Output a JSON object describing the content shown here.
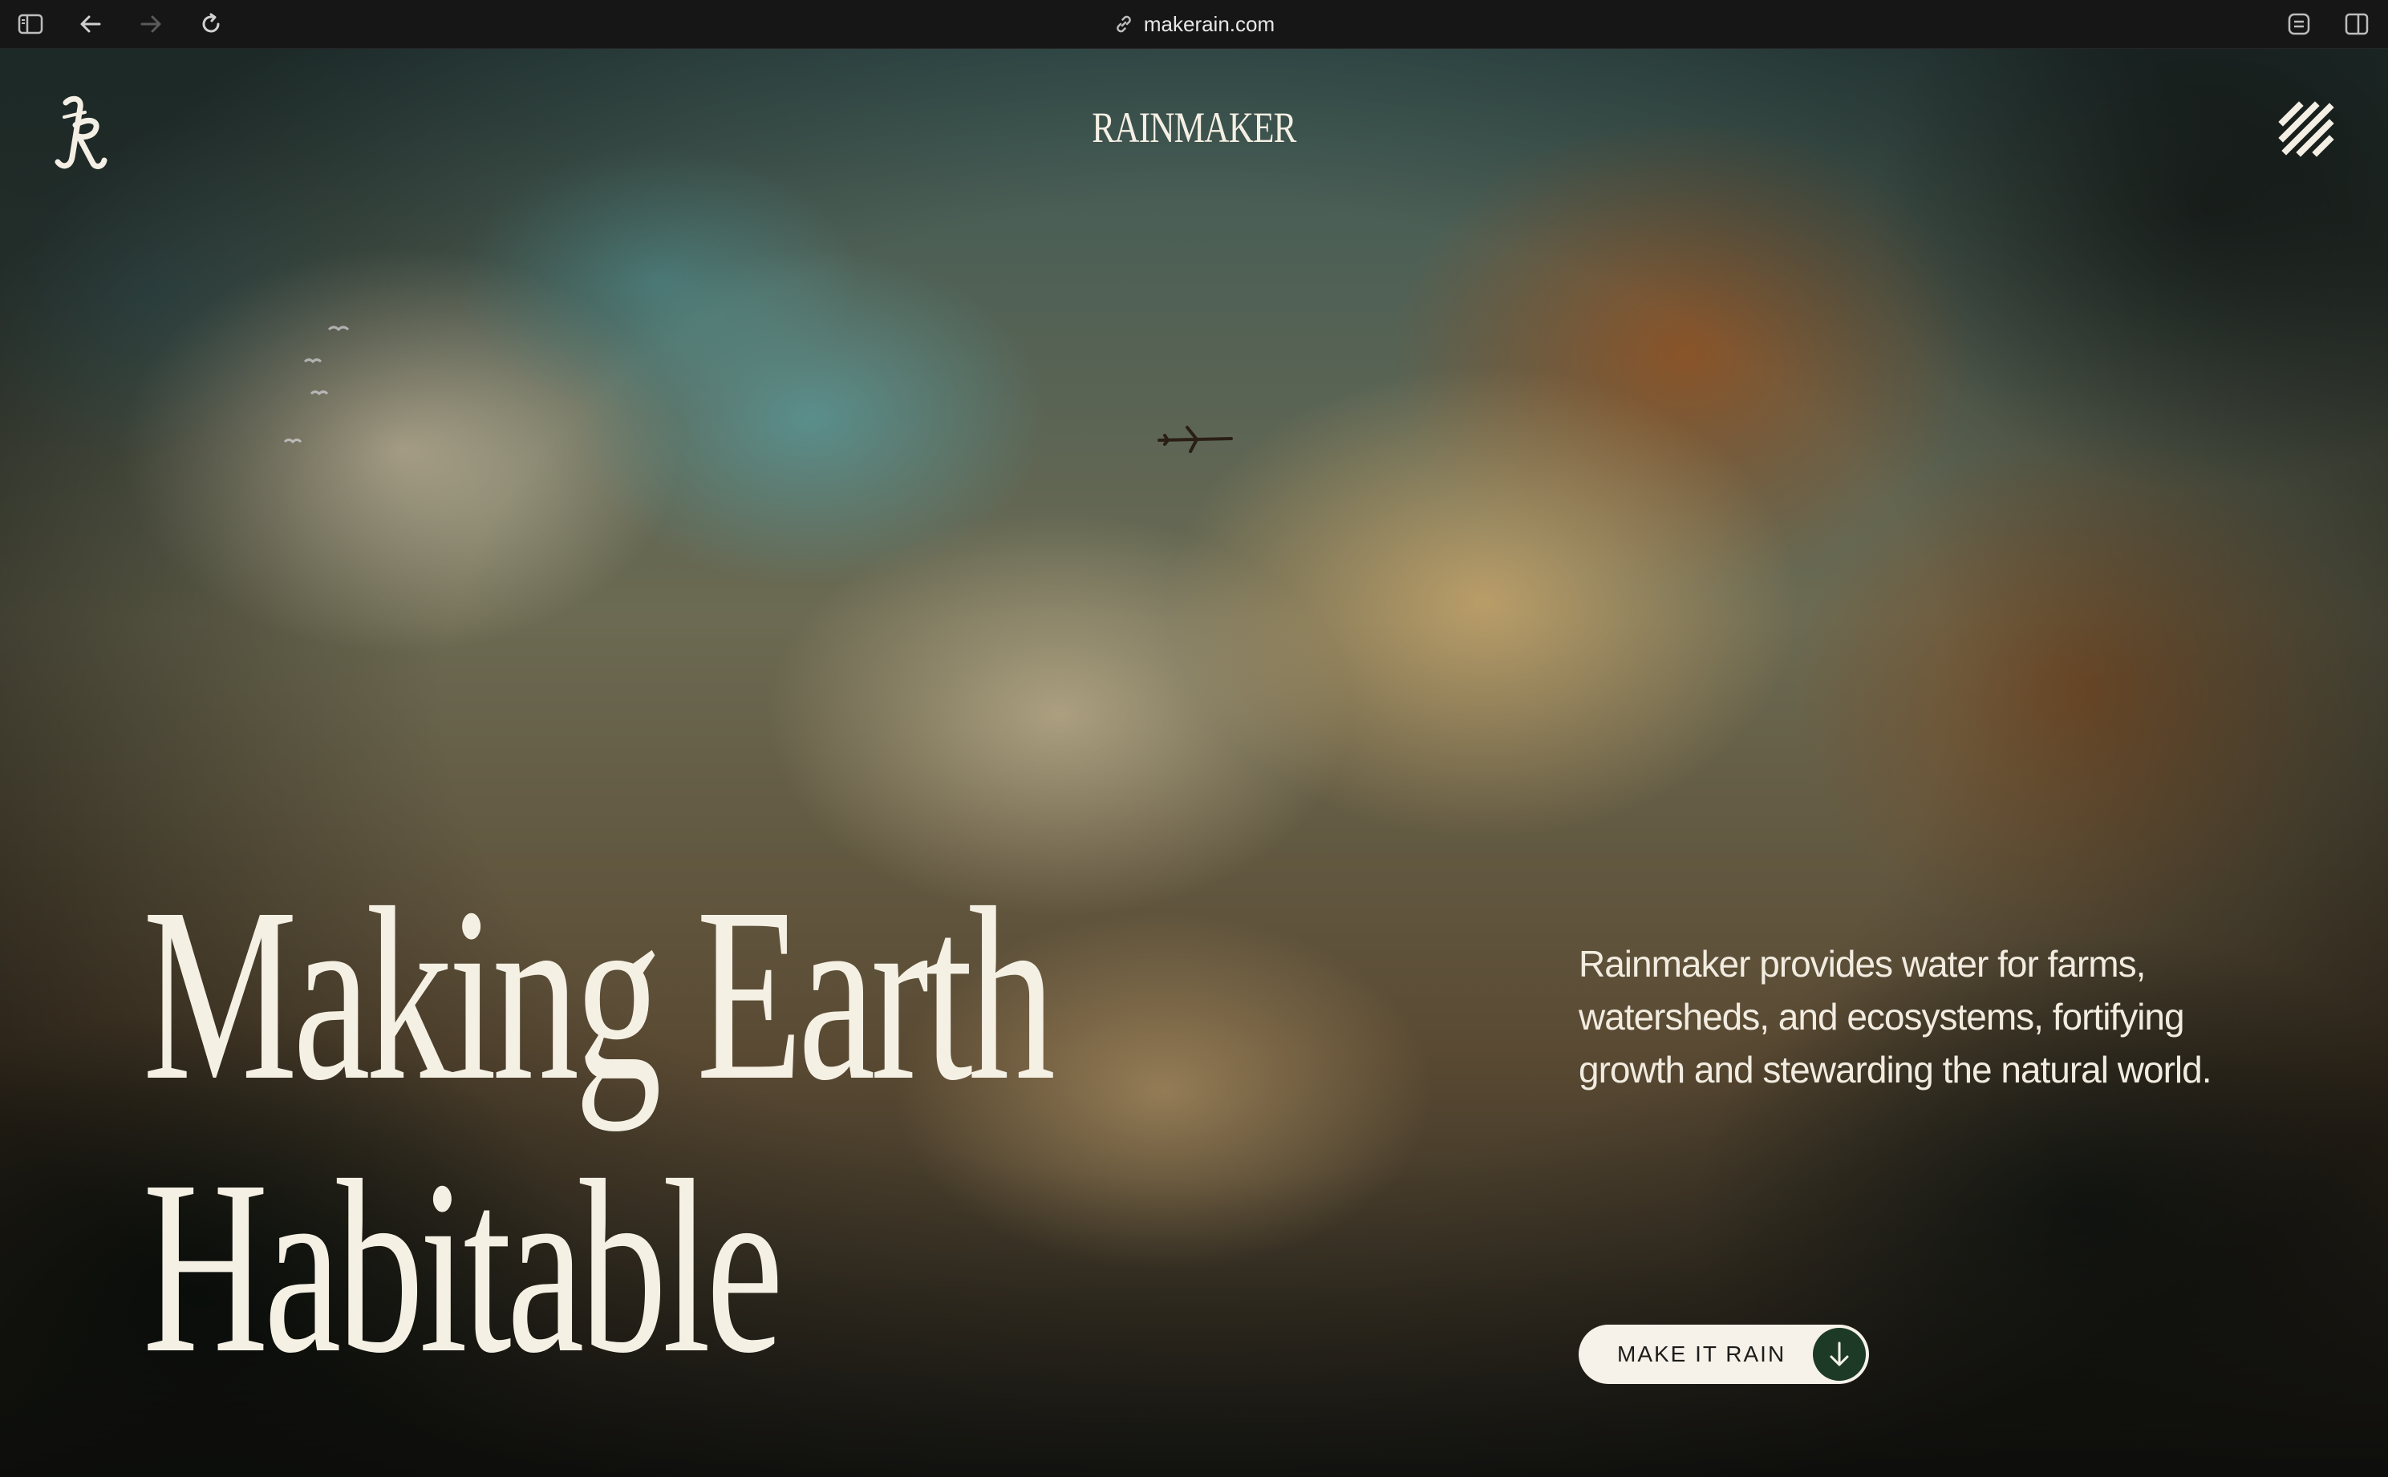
{
  "browser": {
    "url": "makerain.com",
    "icons": [
      "sidebar-icon",
      "back-arrow-icon",
      "forward-arrow-icon",
      "reload-icon",
      "link-icon",
      "extension-icon",
      "split-view-icon"
    ]
  },
  "site": {
    "brand": "RAINMAKER",
    "logo_icon": "blackletter-r-logo",
    "menu_icon": "hamburger-slash-icon"
  },
  "hero": {
    "headline_line1": "Making Earth",
    "headline_line2": "Habitable",
    "tagline": "Rainmaker provides water for farms, watersheds, and ecosystems, fortifying growth and stewarding the natural world.",
    "cta_label": "MAKE IT RAIN",
    "cta_icon": "arrow-down-icon"
  },
  "colors": {
    "cta_background": "#f6f2ea",
    "cta_arrow_circle": "#1d3a27",
    "text_light": "#f5f0e4",
    "chrome_background": "#161616"
  }
}
